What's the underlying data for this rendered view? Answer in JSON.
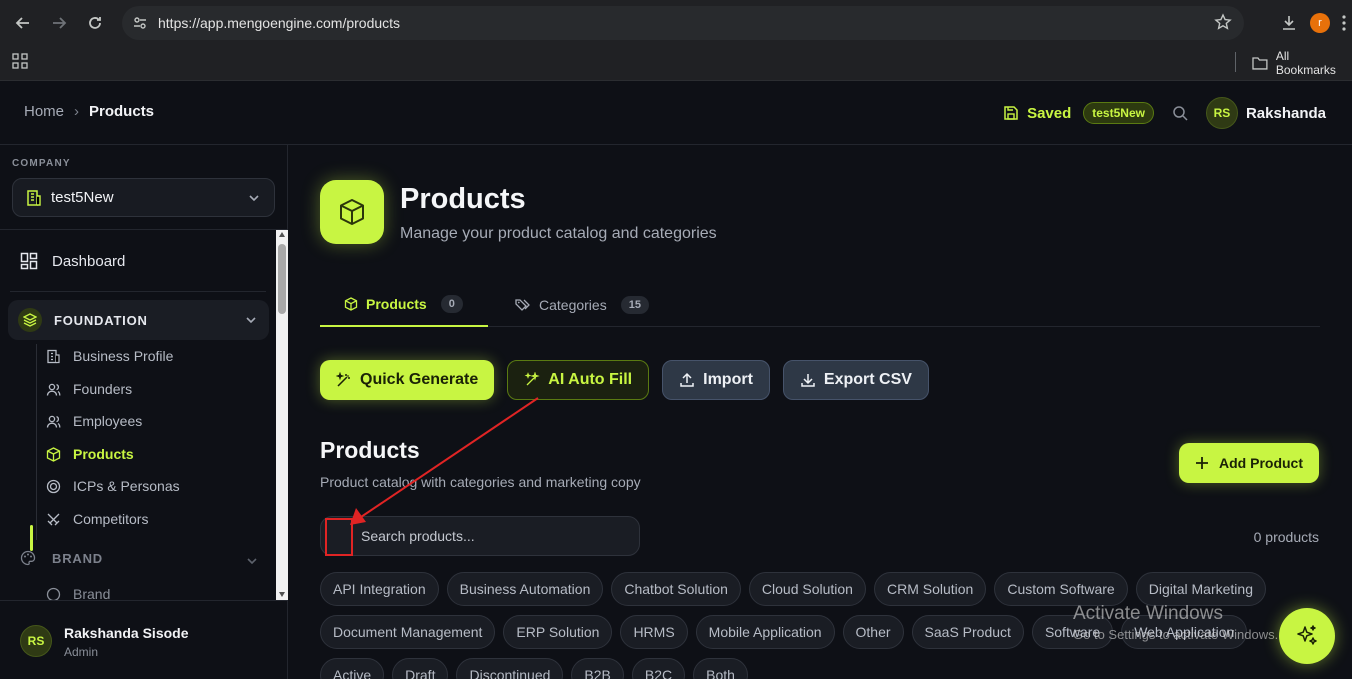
{
  "browser": {
    "url": "https://app.mengoengine.com/products",
    "profile_initial": "r",
    "all_bookmarks": "All Bookmarks"
  },
  "header": {
    "breadcrumb_home": "Home",
    "breadcrumb_sep": "›",
    "breadcrumb_current": "Products",
    "saved_label": "Saved",
    "workspace_badge": "test5New",
    "user_initials": "RS",
    "user_name": "Rakshanda"
  },
  "sidebar": {
    "company_label": "COMPANY",
    "company_name": "test5New",
    "dashboard": "Dashboard",
    "foundation": "FOUNDATION",
    "items": [
      {
        "label": "Business Profile",
        "icon": "building-icon"
      },
      {
        "label": "Founders",
        "icon": "users-icon"
      },
      {
        "label": "Employees",
        "icon": "users-icon"
      },
      {
        "label": "Products",
        "icon": "box-icon",
        "active": true
      },
      {
        "label": "ICPs & Personas",
        "icon": "target-icon"
      },
      {
        "label": "Competitors",
        "icon": "swords-icon"
      }
    ],
    "brand": "BRAND",
    "brand_item": "Brand",
    "footer_initials": "RS",
    "footer_name": "Rakshanda Sisode",
    "footer_role": "Admin"
  },
  "page": {
    "title": "Products",
    "subtitle": "Manage your product catalog and categories",
    "tabs": [
      {
        "label": "Products",
        "count": "0"
      },
      {
        "label": "Categories",
        "count": "15"
      }
    ],
    "actions": {
      "quick_generate": "Quick Generate",
      "ai_auto_fill": "AI Auto Fill",
      "import": "Import",
      "export_csv": "Export CSV"
    },
    "section_title": "Products",
    "section_subtitle": "Product catalog with categories and marketing copy",
    "add_product": "Add Product",
    "search_placeholder": "Search products...",
    "product_count": "0 products",
    "chips_row1": [
      "API Integration",
      "Business Automation",
      "Chatbot Solution",
      "Cloud Solution",
      "CRM Solution",
      "Custom Software",
      "Digital Marketing"
    ],
    "chips_row2": [
      "Document Management",
      "ERP Solution",
      "HRMS",
      "Mobile Application",
      "Other",
      "SaaS Product",
      "Software",
      "Web Application"
    ],
    "chips_row3": [
      "Active",
      "Draft",
      "Discontinued",
      "B2B",
      "B2C",
      "Both"
    ]
  },
  "watermark": {
    "line1": "Activate Windows",
    "line2": "Go to Settings to activate Windows."
  },
  "colors": {
    "accent": "#c8f542",
    "annotation": "#e02424"
  }
}
